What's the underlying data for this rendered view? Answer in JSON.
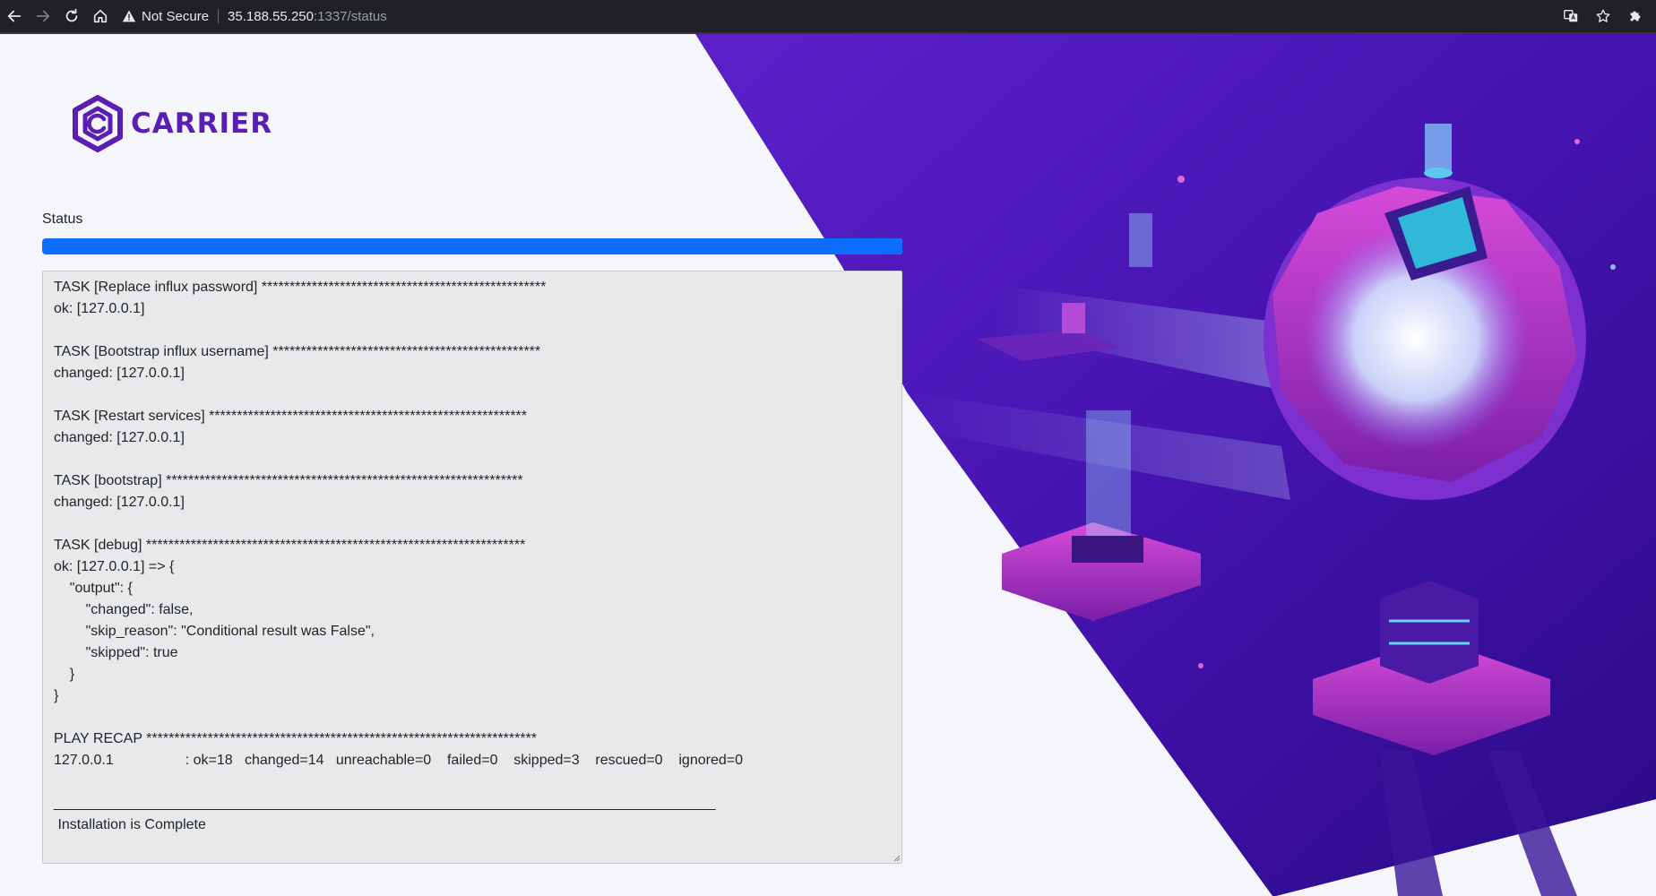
{
  "browser": {
    "security_label": "Not Secure",
    "url_host": "35.188.55.250",
    "url_path": ":1337/status"
  },
  "brand": {
    "name": "CARRIER",
    "color": "#5a1fb2"
  },
  "status": {
    "label": "Status",
    "progress_fraction": 1.0,
    "bar_color": "#0d6efd"
  },
  "log": {
    "text": "TASK [Replace influx password] ***************************************************\nok: [127.0.0.1]\n\nTASK [Bootstrap influx username] ************************************************\nchanged: [127.0.0.1]\n\nTASK [Restart services] *********************************************************\nchanged: [127.0.0.1]\n\nTASK [bootstrap] ****************************************************************\nchanged: [127.0.0.1]\n\nTASK [debug] ********************************************************************\nok: [127.0.0.1] => {\n    \"output\": {\n        \"changed\": false,\n        \"skip_reason\": \"Conditional result was False\",\n        \"skipped\": true\n    }\n}\n\nPLAY RECAP **********************************************************************\n127.0.0.1                  : ok=18   changed=14   unreachable=0    failed=0    skipped=3    rescued=0    ignored=0\n\n___________________________________________________________________________________\n Installation is Complete"
  },
  "icons": {
    "back": "arrow-left-icon",
    "forward": "arrow-right-icon",
    "reload": "reload-icon",
    "home": "home-icon",
    "warning": "warning-triangle-icon",
    "translate": "translate-icon",
    "bookmark": "star-icon",
    "extensions": "puzzle-icon"
  },
  "theme": {
    "hero_purple_dark": "#3a0ca3",
    "hero_purple_light": "#7b2ff7",
    "accent_pink": "#e040fb"
  }
}
